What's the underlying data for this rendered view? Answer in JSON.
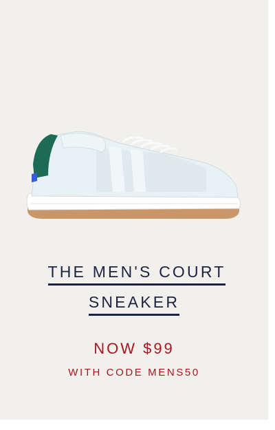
{
  "product": {
    "name_line_1": "THE MEN'S COURT",
    "name_line_2": "SNEAKER",
    "price_text": "NOW $99",
    "promo_text": "WITH CODE MENS50",
    "image_icon": "sneaker-icon"
  },
  "colors": {
    "background": "#f2f0ed",
    "title": "#1c2340",
    "price": "#a5181d",
    "heel_tab": "#1e6b55",
    "heel_accent": "#2f5fd6",
    "outsole": "#c9966a"
  }
}
